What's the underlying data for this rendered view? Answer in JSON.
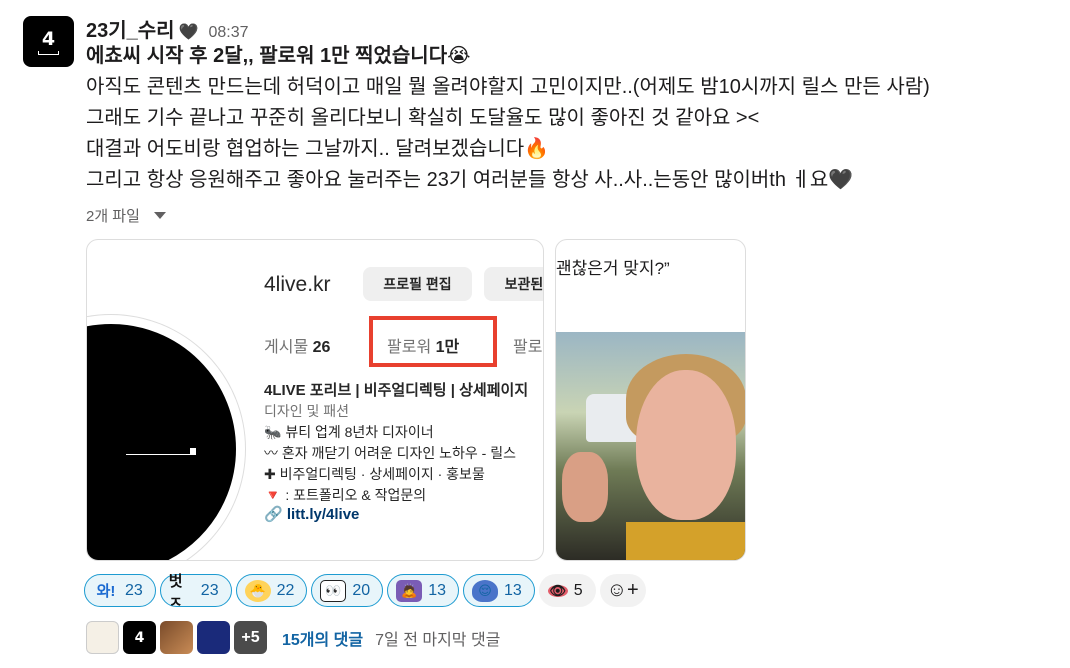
{
  "message": {
    "avatar_text": "4",
    "username": "23기_수리",
    "status_emoji": "🖤",
    "time": "08:37",
    "lines": [
      "에쵸씨 시작 후 2달,, 팔로워 1만 찍었습니다😭",
      "아직도 콘텐츠 만드는데 허덕이고 매일 뭘 올려야할지 고민이지만..(어제도 밤10시까지 릴스 만든 사람)",
      "그래도 기수 끝나고 꾸준히 올리다보니 확실히 도달율도 많이 좋아진 것 같아요 ><",
      "대결과 어도비랑 협업하는 그날까지.. 달려보겠습니다🔥",
      "그리고 항상 응원해주고 좋아요 눌러주는 23기 여러분들 항상 사..사..는동안 많이버th ㅔ요🖤"
    ]
  },
  "files": {
    "label": "2개 파일"
  },
  "instagram_card": {
    "username": "4live.kr",
    "btn_edit": "프로필 편집",
    "btn_saved": "보관된",
    "posts_label": "게시물",
    "posts_value": "26",
    "followers_label": "팔로워",
    "followers_value": "1만",
    "following_label": "팔로",
    "bio_name": "4LIVE 포리브 | 비주얼디렉팅 | 상세페이지",
    "bio_category": "디자인 및 패션",
    "bio_rows": [
      "🐜 뷰티 업계 8년차 디자이너",
      "〰 혼자 깨닫기 어려운 디자인 노하우 - 릴스",
      "✚ 비주얼디렉팅 · 상세페이지 · 홍보물",
      "🔻 : 포트폴리오 & 작업문의"
    ],
    "link": "litt.ly/4live"
  },
  "meme_card": {
    "caption": "괜찮은거 맞지?”"
  },
  "reactions": [
    {
      "emoji": "와!",
      "count": "23"
    },
    {
      "emoji": "벗ㅈ",
      "count": "23"
    },
    {
      "emoji": "🐣",
      "count": "22"
    },
    {
      "emoji": "👀",
      "count": "20"
    },
    {
      "emoji": "🙇",
      "count": "13"
    },
    {
      "emoji": "😌",
      "count": "13"
    },
    {
      "emoji": "👁",
      "count": "5"
    }
  ],
  "add_reaction": "☺+",
  "thread": {
    "avatar2_text": "4",
    "more": "+5",
    "reply_count": "15개의 댓글",
    "last_reply": "7일 전 마지막 댓글"
  }
}
